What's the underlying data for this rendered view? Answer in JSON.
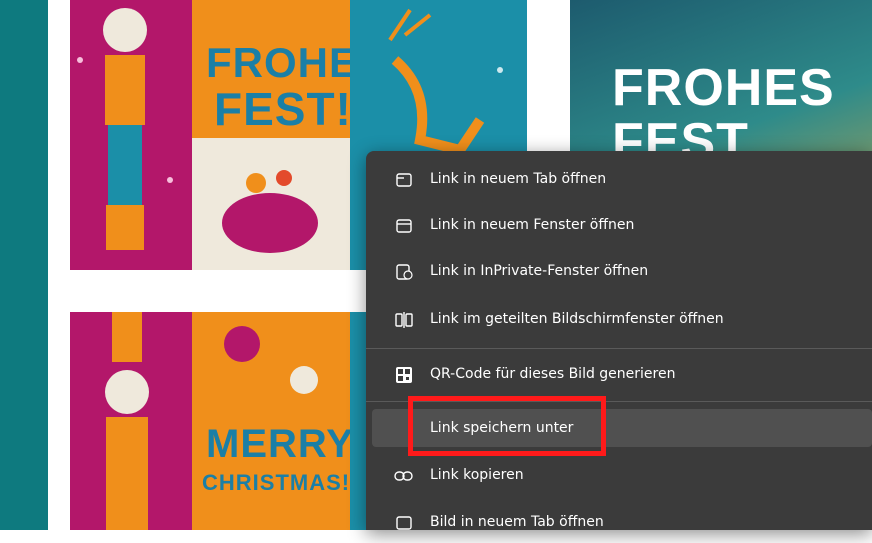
{
  "cards": {
    "card1_text": [
      "FROHES",
      "FEST!"
    ],
    "card2_text": [
      "MERRY",
      "CHRISTMAS!"
    ],
    "card3_text": [
      "FROHES",
      "FEST"
    ]
  },
  "context_menu": {
    "items": [
      {
        "label": "Link in neuem Tab öffnen",
        "icon": "tab-icon"
      },
      {
        "label": "Link in neuem Fenster öffnen",
        "icon": "window-icon"
      },
      {
        "label": "Link in InPrivate-Fenster öffnen",
        "icon": "inprivate-icon"
      },
      {
        "label": "Link im geteilten Bildschirmfenster öffnen",
        "icon": "split-screen-icon"
      },
      {
        "label": "QR-Code für dieses Bild generieren",
        "icon": "qr-code-icon"
      },
      {
        "label": "Link speichern unter",
        "icon": ""
      },
      {
        "label": "Link kopieren",
        "icon": "link-icon"
      },
      {
        "label": "Bild in neuem Tab öffnen",
        "icon": "image-tab-icon"
      }
    ],
    "hovered_item": "Link speichern unter"
  },
  "colors": {
    "menu_bg": "#3b3b3b",
    "highlight_border": "#ff1a1a",
    "teal_strip": "#0e7a7f"
  }
}
